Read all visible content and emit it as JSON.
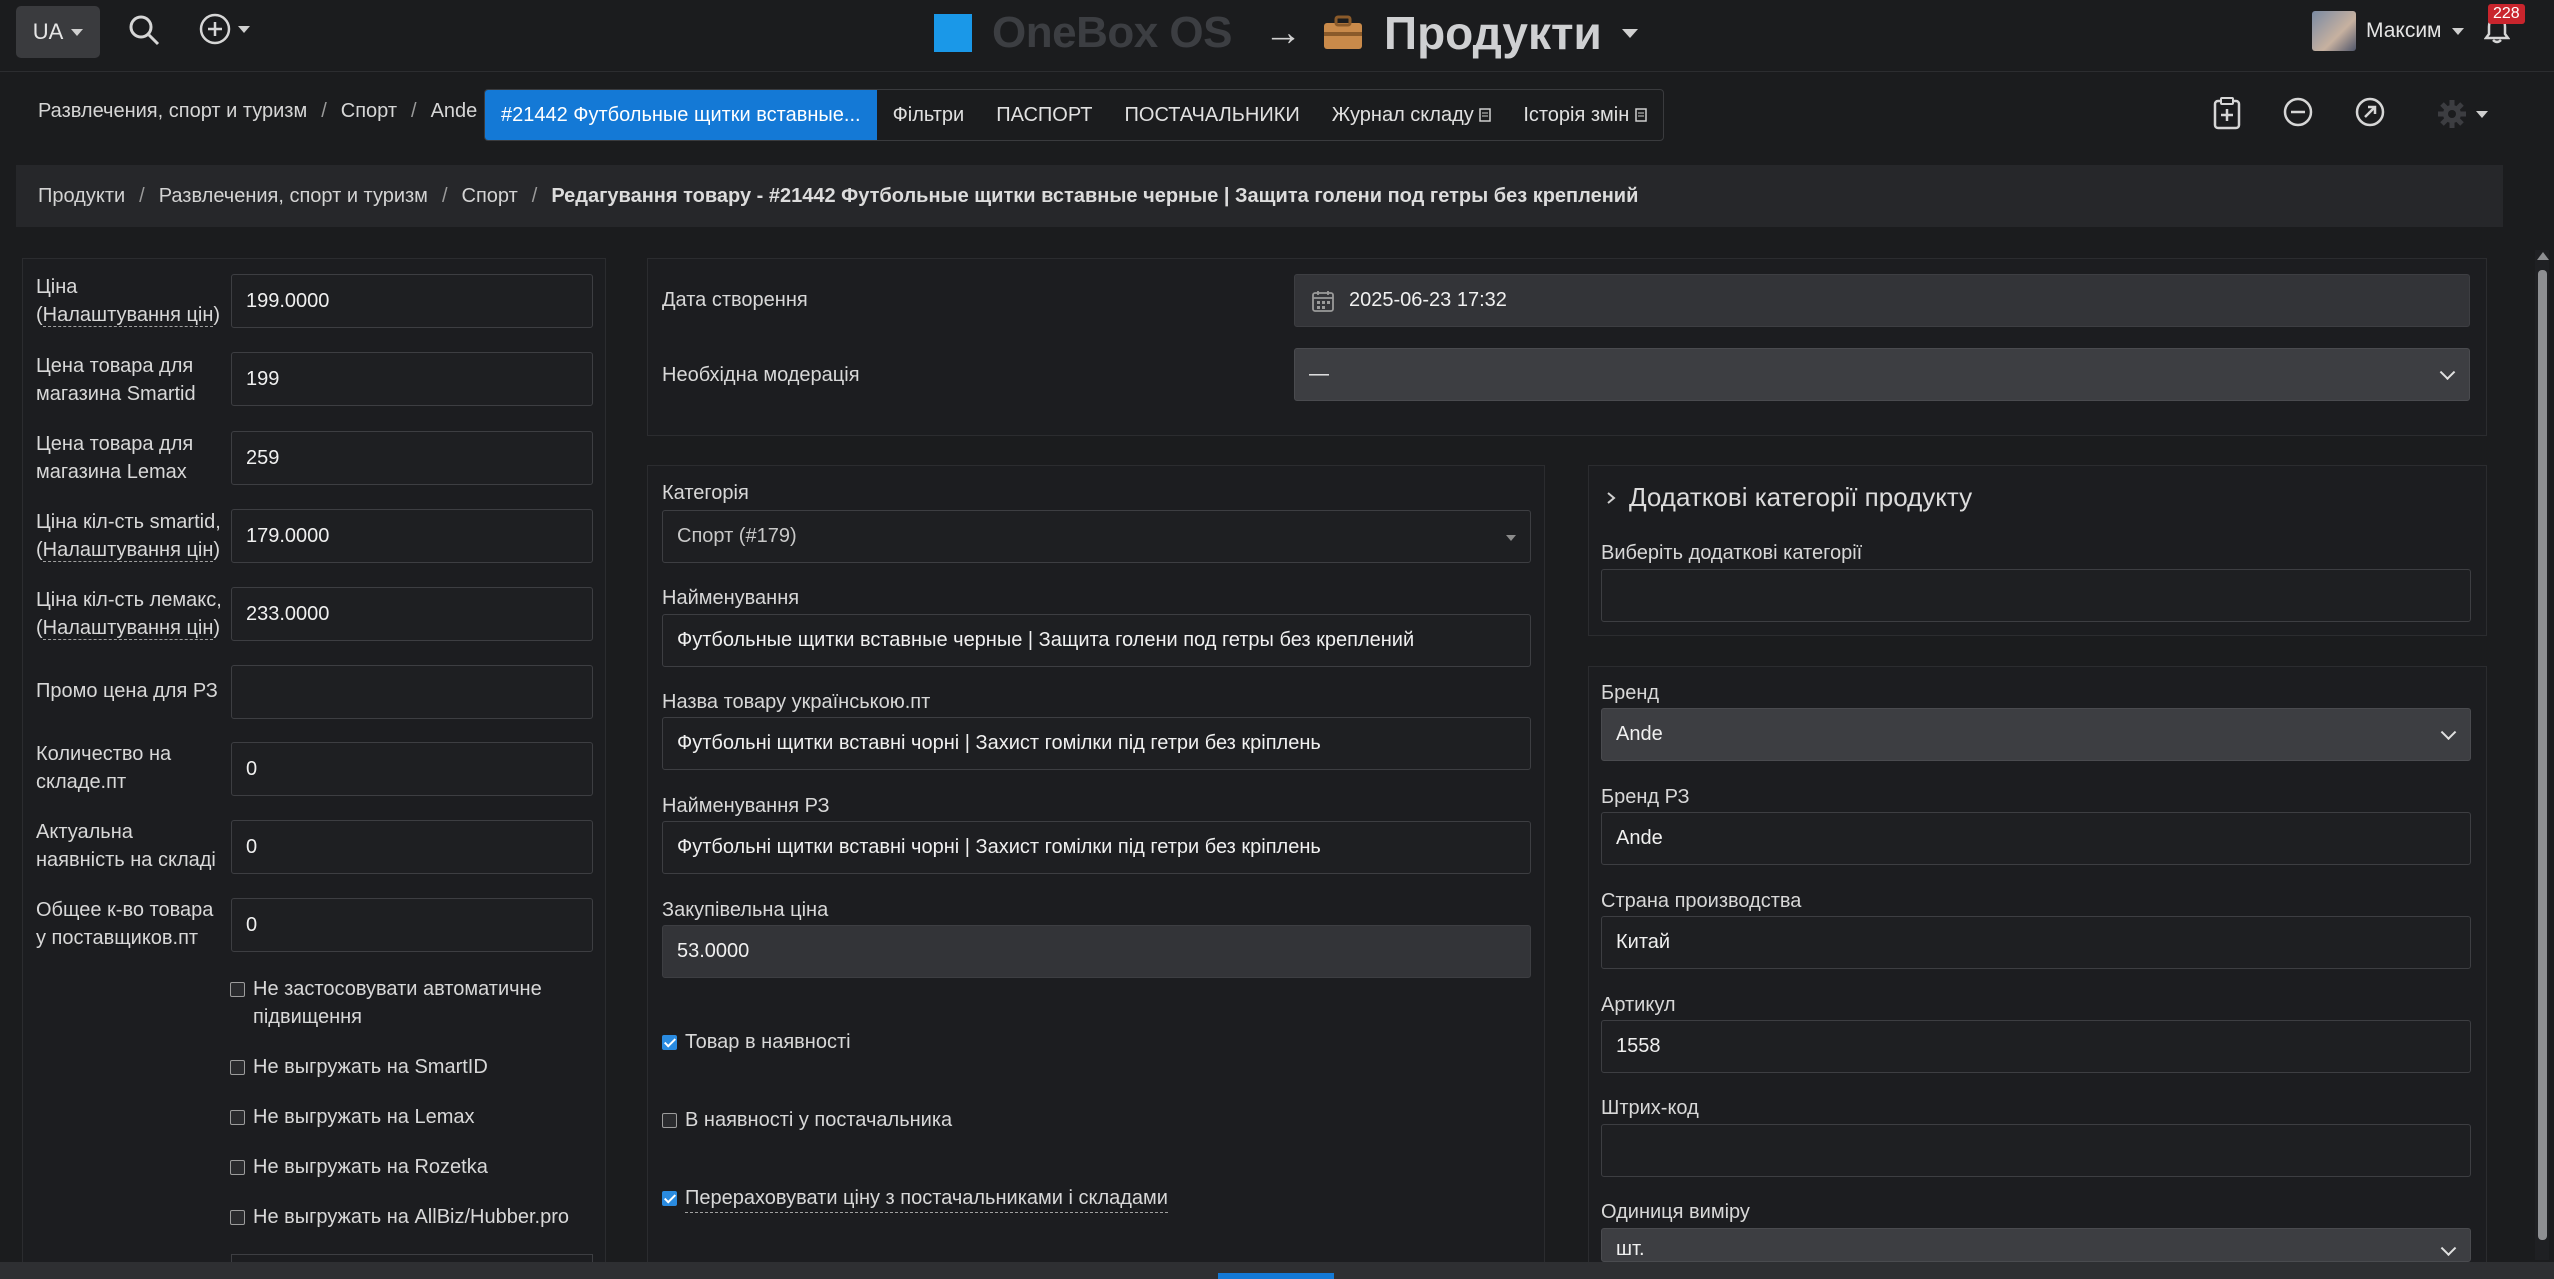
{
  "topbar": {
    "lang": "UA",
    "brand_name": "OneBox OS",
    "arrow": "→",
    "page_title": "Продукти",
    "user_name": "Максим",
    "notifications_count": "228"
  },
  "top_crumbs": [
    "Развлечения, спорт и туризм",
    "Спорт",
    "Ande"
  ],
  "tabs": [
    {
      "label": "#21442 Футбольные щитки вставные..."
    },
    {
      "label": "Фільтри"
    },
    {
      "label": "ПАСПОРТ"
    },
    {
      "label": "ПОСТАЧАЛЬНИКИ"
    },
    {
      "label": "Журнал складу"
    },
    {
      "label": "Історія змін"
    }
  ],
  "breadcrumb": {
    "items": [
      "Продукти",
      "Развлечения, спорт и туризм",
      "Спорт"
    ],
    "current": "Редагування товару - #21442 Футбольные щитки вставные черные | Защита голени под гетры без креплений"
  },
  "left": {
    "fields": [
      {
        "label_a": "Ціна (",
        "label_link": "Налаштування цін",
        "label_b": ")",
        "value": "199.0000"
      },
      {
        "label": "Цена товара для магазина Smartid",
        "value": "199"
      },
      {
        "label": "Цена товара для магазина Lemax",
        "value": "259"
      },
      {
        "label_a": "Ціна кіл-сть smartid, (",
        "label_link": "Налаштування цін",
        "label_b": ")",
        "value": "179.0000"
      },
      {
        "label_a": "Ціна кіл-сть лемакс, (",
        "label_link": "Налаштування цін",
        "label_b": ")",
        "value": "233.0000"
      },
      {
        "label": "Промо цена для РЗ",
        "value": ""
      },
      {
        "label": "Количество на складе.пт",
        "value": "0"
      },
      {
        "label": "Актуальна наявність на складі",
        "value": "0"
      },
      {
        "label": "Общее к-во товара у поставщиков.пт",
        "value": "0"
      }
    ],
    "checkboxes": [
      {
        "label": "Не застосовувати автоматичне підвищення",
        "checked": false
      },
      {
        "label": "Не выгружать на SmartID",
        "checked": false
      },
      {
        "label": "Не выгружать на Lemax",
        "checked": false
      },
      {
        "label": "Не выгружать на Rozetka",
        "checked": false
      },
      {
        "label": "Не выгружать на AllBiz/Hubber.pro",
        "checked": false
      }
    ]
  },
  "top_form": {
    "created_label": "Дата створення",
    "created_value": "2025-06-23 17:32",
    "moderation_label": "Необхідна модерація",
    "moderation_value": "—"
  },
  "middle": {
    "category_label": "Категорія",
    "category_value": "Спорт (#179)",
    "name_label": "Найменування",
    "name_value": "Футбольные щитки вставные черные | Защита голени под гетры без креплений",
    "name_ua_label": "Назва товару українською.пт",
    "name_ua_value": "Футбольні щитки вставні чорні | Захист гомілки під гетри без кріплень",
    "name_rz_label": "Найменування РЗ",
    "name_rz_value": "Футбольні щитки вставні чорні | Захист гомілки під гетри без кріплень",
    "purchase_label": "Закупівельна ціна",
    "purchase_value": "53.0000",
    "checkboxes": [
      {
        "label": "Товар в наявності",
        "checked": true
      },
      {
        "label": "В наявності у постачальника",
        "checked": false
      },
      {
        "label": "Перераховувати ціну з постачальниками і складами",
        "checked": true
      }
    ]
  },
  "right": {
    "extra_cat_title": "Додаткові категорії продукту",
    "extra_cat_label": "Виберіть додаткові категорії",
    "extra_cat_value": "",
    "brand_label": "Бренд",
    "brand_value": "Ande",
    "brand_rz_label": "Бренд РЗ",
    "brand_rz_value": "Ande",
    "country_label": "Страна производства",
    "country_value": "Китай",
    "sku_label": "Артикул",
    "sku_value": "1558",
    "barcode_label": "Штрих-код",
    "barcode_value": "",
    "unit_label": "Одиниця виміру",
    "unit_value": "шт."
  },
  "colors": {
    "accent": "#1479d6",
    "brand_square": "#1a98e8",
    "badge": "#c9252d",
    "background": "#1b1c1e"
  }
}
